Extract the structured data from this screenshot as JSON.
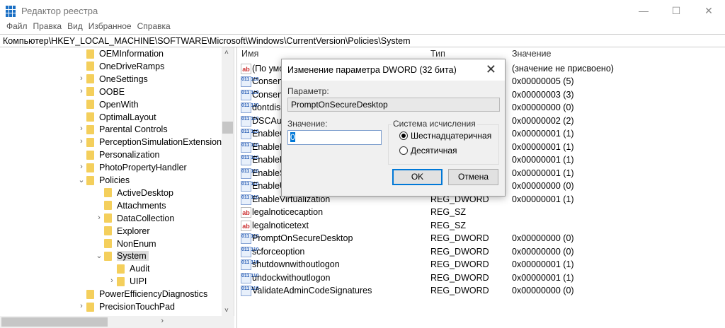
{
  "window": {
    "title": "Редактор реестра",
    "minimize": "—",
    "maximize": "☐",
    "close": "✕"
  },
  "menu": [
    "Файл",
    "Правка",
    "Вид",
    "Избранное",
    "Справка"
  ],
  "address": "Компьютер\\HKEY_LOCAL_MACHINE\\SOFTWARE\\Microsoft\\Windows\\CurrentVersion\\Policies\\System",
  "tree": [
    {
      "label": "OEMInformation",
      "level": 1,
      "arrow": ""
    },
    {
      "label": "OneDriveRamps",
      "level": 1,
      "arrow": ""
    },
    {
      "label": "OneSettings",
      "level": 1,
      "arrow": "›"
    },
    {
      "label": "OOBE",
      "level": 1,
      "arrow": "›"
    },
    {
      "label": "OpenWith",
      "level": 1,
      "arrow": ""
    },
    {
      "label": "OptimalLayout",
      "level": 1,
      "arrow": ""
    },
    {
      "label": "Parental Controls",
      "level": 1,
      "arrow": "›"
    },
    {
      "label": "PerceptionSimulationExtensions",
      "level": 1,
      "arrow": "›"
    },
    {
      "label": "Personalization",
      "level": 1,
      "arrow": ""
    },
    {
      "label": "PhotoPropertyHandler",
      "level": 1,
      "arrow": "›"
    },
    {
      "label": "Policies",
      "level": 1,
      "arrow": "⌄"
    },
    {
      "label": "ActiveDesktop",
      "level": 2,
      "arrow": ""
    },
    {
      "label": "Attachments",
      "level": 2,
      "arrow": ""
    },
    {
      "label": "DataCollection",
      "level": 2,
      "arrow": "›"
    },
    {
      "label": "Explorer",
      "level": 2,
      "arrow": ""
    },
    {
      "label": "NonEnum",
      "level": 2,
      "arrow": ""
    },
    {
      "label": "System",
      "level": 2,
      "arrow": "⌄",
      "selected": true
    },
    {
      "label": "Audit",
      "level": 3,
      "arrow": ""
    },
    {
      "label": "UIPI",
      "level": 3,
      "arrow": "›"
    },
    {
      "label": "PowerEfficiencyDiagnostics",
      "level": 1,
      "arrow": ""
    },
    {
      "label": "PrecisionTouchPad",
      "level": 1,
      "arrow": "›"
    }
  ],
  "list": {
    "headers": {
      "name": "Имя",
      "type": "Тип",
      "value": "Значение"
    },
    "rows": [
      {
        "icon": "sz",
        "name": "(По умо",
        "type": "",
        "value": "(значение не присвоено)"
      },
      {
        "icon": "dw",
        "name": "Consent",
        "type": "",
        "value": "0x00000005 (5)"
      },
      {
        "icon": "dw",
        "name": "Consent",
        "type": "",
        "value": "0x00000003 (3)"
      },
      {
        "icon": "dw",
        "name": "dontdisp",
        "type": "",
        "value": "0x00000000 (0)"
      },
      {
        "icon": "dw",
        "name": "DSCAuto",
        "type": "",
        "value": "0x00000002 (2)"
      },
      {
        "icon": "dw",
        "name": "EnableCu",
        "type": "",
        "value": "0x00000001 (1)"
      },
      {
        "icon": "dw",
        "name": "EnableIn",
        "type": "",
        "value": "0x00000001 (1)"
      },
      {
        "icon": "dw",
        "name": "EnableLU",
        "type": "",
        "value": "0x00000001 (1)"
      },
      {
        "icon": "dw",
        "name": "EnableSe",
        "type": "",
        "value": "0x00000001 (1)"
      },
      {
        "icon": "dw",
        "name": "EnableUI",
        "type": "",
        "value": "0x00000000 (0)"
      },
      {
        "icon": "dw",
        "name": "EnableVirtualization",
        "type": "REG_DWORD",
        "value": "0x00000001 (1)"
      },
      {
        "icon": "sz",
        "name": "legalnoticecaption",
        "type": "REG_SZ",
        "value": ""
      },
      {
        "icon": "sz",
        "name": "legalnoticetext",
        "type": "REG_SZ",
        "value": ""
      },
      {
        "icon": "dw",
        "name": "PromptOnSecureDesktop",
        "type": "REG_DWORD",
        "value": "0x00000000 (0)"
      },
      {
        "icon": "dw",
        "name": "scforceoption",
        "type": "REG_DWORD",
        "value": "0x00000000 (0)"
      },
      {
        "icon": "dw",
        "name": "shutdownwithoutlogon",
        "type": "REG_DWORD",
        "value": "0x00000001 (1)"
      },
      {
        "icon": "dw",
        "name": "undockwithoutlogon",
        "type": "REG_DWORD",
        "value": "0x00000001 (1)"
      },
      {
        "icon": "dw",
        "name": "ValidateAdminCodeSignatures",
        "type": "REG_DWORD",
        "value": "0x00000000 (0)"
      }
    ]
  },
  "dialog": {
    "title": "Изменение параметра DWORD (32 бита)",
    "param_label": "Параметр:",
    "param_value": "PromptOnSecureDesktop",
    "value_label": "Значение:",
    "value": "0",
    "base_label": "Система исчисления",
    "hex": "Шестнадцатеричная",
    "dec": "Десятичная",
    "ok": "OK",
    "cancel": "Отмена"
  },
  "colors": {
    "accent": "#0078d7",
    "folder": "#f4cf5c"
  }
}
